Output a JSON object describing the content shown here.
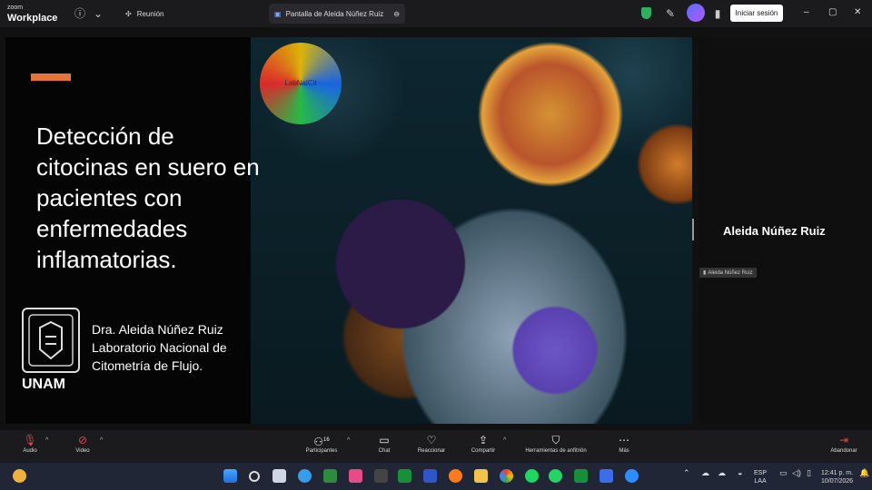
{
  "app": {
    "brand_top": "zoom",
    "brand_name": "Workplace"
  },
  "titlebar": {
    "meeting_tab": "Reunión",
    "share_tab": "Pantalla de Aleida Núñez Ruiz",
    "signin_label": "Iniciar sesión",
    "window": {
      "minimize": "–",
      "restore": "▢",
      "close": "✕"
    }
  },
  "slide": {
    "title": "Detección de citocinas en suero en pacientes con enfermedades inflamatorias.",
    "presenter_name": "Dra. Aleida Núñez Ruiz",
    "presenter_org_line1": "Laboratorio Nacional de",
    "presenter_org_line2": "Citometría de Flujo.",
    "institution": "UNAM",
    "logo_text": "LabNalCit",
    "accent_color": "#e4743a"
  },
  "side_panel": {
    "speaker_name": "Aleida Núñez Ruiz",
    "speaker_tag": "Aleida Núñez Ruiz"
  },
  "controls": {
    "audio": "Audio",
    "video": "Video",
    "participants": "Participantes",
    "participants_count": "16",
    "chat": "Chat",
    "react": "Reaccionar",
    "share": "Compartir",
    "host_tools": "Herramientas de anfitrión",
    "more": "Más",
    "leave": "Abandonar"
  },
  "taskbar": {
    "lang_line1": "ESP",
    "lang_line2": "LAA",
    "time": "12:41 p. m.",
    "date": "10/07/2026"
  }
}
